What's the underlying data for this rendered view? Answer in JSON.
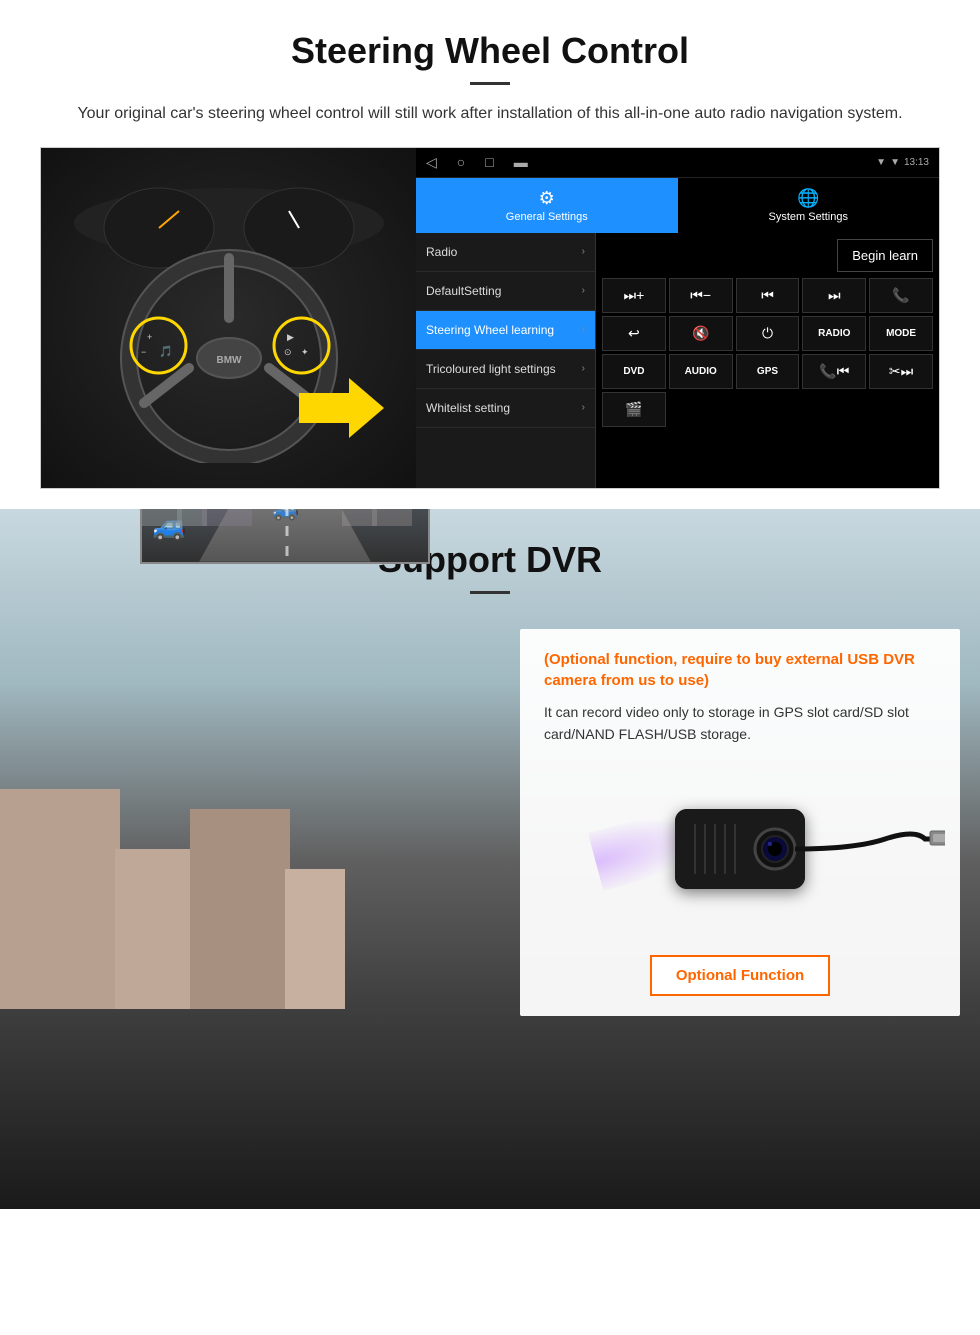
{
  "steering_section": {
    "title": "Steering Wheel Control",
    "description": "Your original car's steering wheel control will still work after installation of this all-in-one auto radio navigation system.",
    "status_bar": {
      "time": "13:13",
      "icons": [
        "▼",
        "▼",
        "⬛"
      ]
    },
    "tabs": [
      {
        "label": "General Settings",
        "icon": "⚙",
        "active": true
      },
      {
        "label": "System Settings",
        "icon": "🌐",
        "active": false
      }
    ],
    "menu_items": [
      {
        "label": "Radio",
        "active": false
      },
      {
        "label": "DefaultSetting",
        "active": false
      },
      {
        "label": "Steering Wheel learning",
        "active": true
      },
      {
        "label": "Tricoloured light settings",
        "active": false
      },
      {
        "label": "Whitelist setting",
        "active": false
      }
    ],
    "begin_learn_label": "Begin learn",
    "control_buttons": [
      {
        "label": "⏭+",
        "type": "icon"
      },
      {
        "label": "⏮−",
        "type": "icon"
      },
      {
        "label": "⏮⏮",
        "type": "icon"
      },
      {
        "label": "⏭⏭",
        "type": "icon"
      },
      {
        "label": "📞",
        "type": "icon"
      },
      {
        "label": "↩",
        "type": "icon"
      },
      {
        "label": "🔇×",
        "type": "icon"
      },
      {
        "label": "⏻",
        "type": "icon"
      },
      {
        "label": "RADIO",
        "type": "text"
      },
      {
        "label": "MODE",
        "type": "text"
      },
      {
        "label": "DVD",
        "type": "text"
      },
      {
        "label": "AUDIO",
        "type": "text"
      },
      {
        "label": "GPS",
        "type": "text"
      },
      {
        "label": "📞⏮",
        "type": "icon"
      },
      {
        "label": "✂⏭",
        "type": "icon"
      },
      {
        "label": "🎬",
        "type": "icon"
      }
    ]
  },
  "dvr_section": {
    "title": "Support DVR",
    "optional_text": "(Optional function, require to buy external USB DVR camera from us to use)",
    "description": "It can record video only to storage in GPS slot card/SD slot card/NAND FLASH/USB storage.",
    "optional_button_label": "Optional Function"
  }
}
